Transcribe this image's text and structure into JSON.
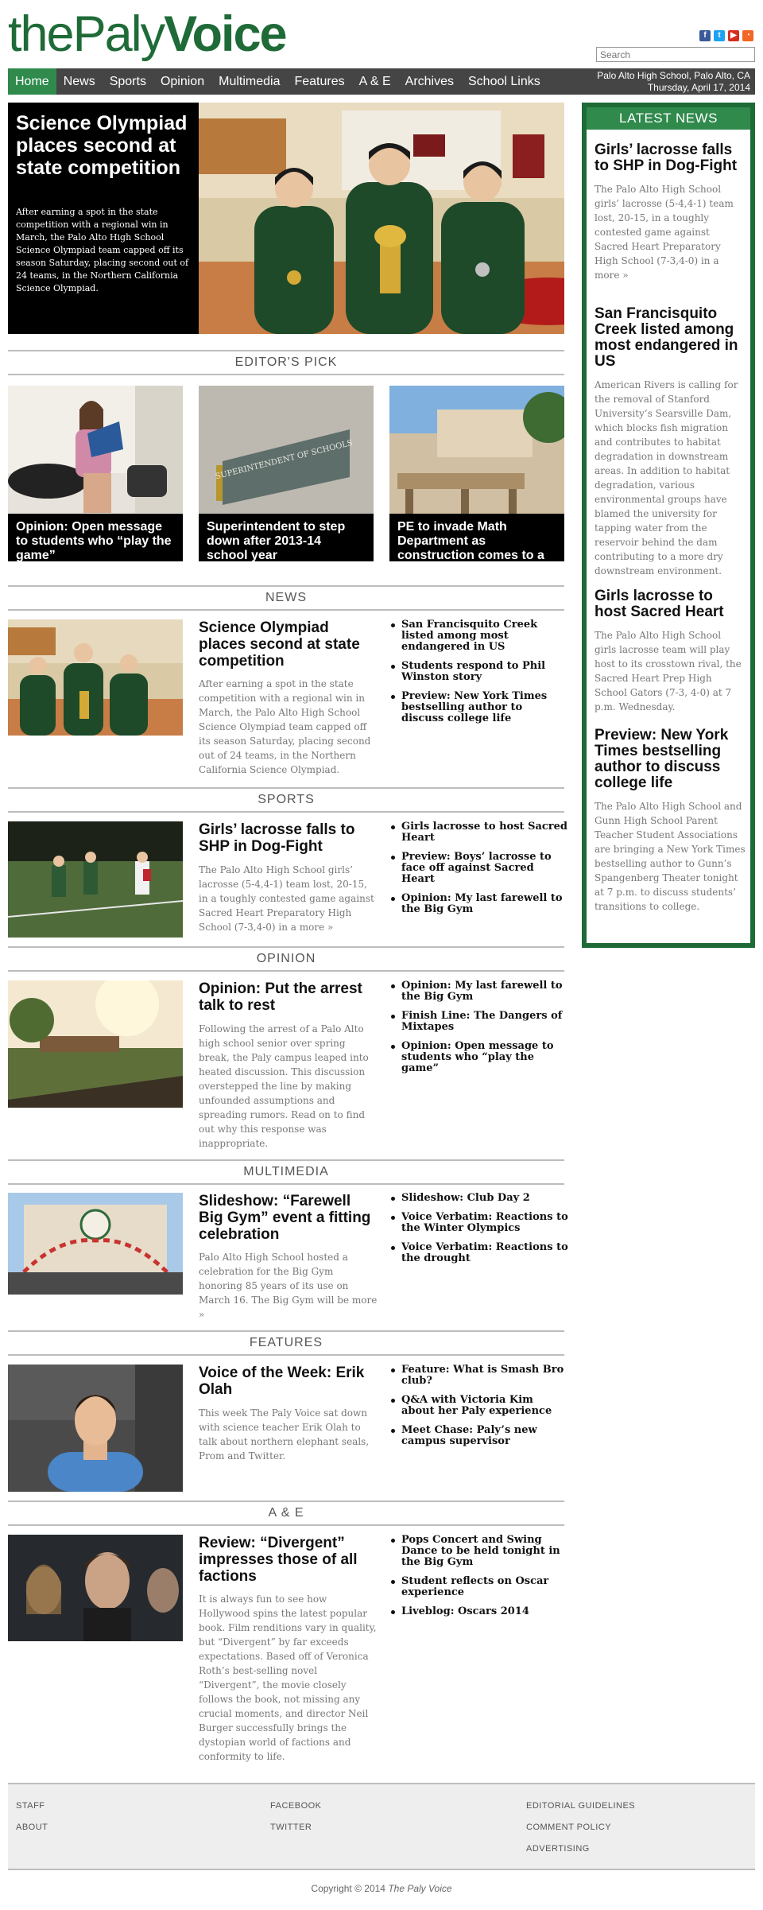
{
  "logo": {
    "part1": "thePaly",
    "part2": "Voice"
  },
  "social": [
    "facebook-icon",
    "twitter-icon",
    "youtube-icon",
    "rss-icon"
  ],
  "search": {
    "placeholder": "Search"
  },
  "nav": {
    "items": [
      "Home",
      "News",
      "Sports",
      "Opinion",
      "Multimedia",
      "Features",
      "A & E",
      "Archives",
      "School Links"
    ],
    "location": "Palo Alto High School, Palo Alto, CA",
    "date": "Thursday, April 17, 2014"
  },
  "hero": {
    "title": "Science Olympiad places second at state competition",
    "dek": "After earning a spot in the state competition with a regional win in March, the Palo Alto High School Science Olympiad team capped off its season Saturday, placing second out of 24 teams, in the Northern California Science Olympiad."
  },
  "editors_pick": {
    "heading": "EDITOR'S PICK",
    "items": [
      {
        "caption": "Opinion: Open message to students who “play the game”"
      },
      {
        "caption": "Superintendent to step down after 2013-14 school year",
        "sign": "SUPERINTENDENT OF SCHOOLS"
      },
      {
        "caption": "PE to invade Math Department as construction comes to a"
      }
    ]
  },
  "sections": {
    "news": {
      "heading": "NEWS",
      "title": "Science Olympiad places second at state competition",
      "body": "After earning a spot in the state competition with a regional win in March, the Palo Alto High School Science Olympiad team capped off its season Saturday, placing second out of 24 teams, in the Northern California Science Olympiad.",
      "links": [
        "San Francisquito Creek listed among most endangered in US",
        "Students respond to Phil Winston story",
        "Preview: New York Times bestselling author to discuss college life"
      ]
    },
    "sports": {
      "heading": "SPORTS",
      "title": "Girls’ lacrosse falls to SHP in Dog-Fight",
      "body": "The Palo Alto High School girls’ lacrosse (5-4,4-1) team lost, 20-15, in a toughly contested game against Sacred Heart Preparatory High School (7-3,4-0) in a more »",
      "links": [
        "Girls lacrosse to host Sacred Heart",
        "Preview: Boys’ lacrosse to face off against Sacred Heart",
        "Opinion: My last farewell to the Big Gym"
      ]
    },
    "opinion": {
      "heading": "OPINION",
      "title": "Opinion: Put the arrest talk to rest",
      "body": "Following the arrest of a Palo Alto high school senior over spring break, the Paly campus leaped into heated discussion. This discussion overstepped the line by making unfounded assumptions and spreading rumors. Read on to find out why this response was inappropriate.",
      "links": [
        "Opinion: My last farewell to the Big Gym",
        "Finish Line: The Dangers of Mixtapes",
        "Opinion: Open message to students who “play the game”"
      ]
    },
    "multimedia": {
      "heading": "MULTIMEDIA",
      "title": "Slideshow: “Farewell Big Gym” event a fitting celebration",
      "body": "Palo Alto High School hosted a celebration for the Big Gym honoring 85 years of its use on March 16. The Big Gym will be more »",
      "links": [
        "Slideshow: Club Day 2",
        "Voice Verbatim: Reactions to the Winter Olympics",
        "Voice Verbatim: Reactions to the drought"
      ]
    },
    "features": {
      "heading": "FEATURES",
      "title": "Voice of the Week: Erik Olah",
      "body": "This week The Paly Voice sat down with science teacher Erik Olah to talk about northern elephant seals, Prom and Twitter.",
      "links": [
        "Feature: What is Smash Bro club?",
        "Q&A with Victoria Kim about her Paly experience",
        "Meet Chase: Paly’s new campus supervisor"
      ]
    },
    "ae": {
      "heading": "A & E",
      "title": "Review: “Divergent” impresses those of all factions",
      "body": "It is always fun to see how Hollywood spins the latest popular book. Film renditions vary in quality, but “Divergent” by far exceeds expectations. Based off of Veronica Roth’s best-selling novel “Divergent”, the movie closely follows the book, not missing any crucial moments, and director Neil Burger successfully brings the dystopian world of factions and conformity to life.",
      "links": [
        "Pops Concert and Swing Dance to be held tonight in the Big Gym",
        "Student reflects on Oscar experience",
        "Liveblog: Oscars 2014"
      ]
    }
  },
  "latest_news": {
    "heading": "LATEST NEWS",
    "items": [
      {
        "title": "Girls’ lacrosse falls to SHP in Dog-Fight",
        "body": "The Palo Alto High School girls’ lacrosse (5-4,4-1) team lost, 20-15, in a toughly contested game against Sacred Heart Preparatory High School (7-3,4-0) in a more »"
      },
      {
        "title": "San Francisquito Creek listed among most endangered in US",
        "body": "American Rivers is calling for the removal of Stanford University’s Searsville Dam, which blocks fish migration and contributes to habitat degradation in downstream areas. In addition to habitat degradation, various environmental groups have blamed the university for tapping water from the reservoir behind the dam contributing to a more dry downstream environment."
      },
      {
        "title": "Girls lacrosse to host Sacred Heart",
        "body": "The Palo Alto High School girls lacrosse team will play host to its crosstown rival, the Sacred Heart Prep High School Gators (7-3, 4-0) at 7 p.m. Wednesday."
      },
      {
        "title": "Preview: New York Times bestselling author to discuss college life",
        "body": "The Palo Alto High School and Gunn High School Parent Teacher Student Associations are bringing a New York Times bestselling author to Gunn’s Spangenberg Theater tonight at 7 p.m. to discuss students’ transitions to college."
      }
    ]
  },
  "footer": {
    "col1": [
      "STAFF",
      "ABOUT"
    ],
    "col2": [
      "FACEBOOK",
      "TWITTER"
    ],
    "col3": [
      "EDITORIAL GUIDELINES",
      "COMMENT POLICY",
      "ADVERTISING"
    ],
    "copyright_prefix": "Copyright © 2014",
    "copyright_name": "The Paly Voice"
  },
  "colors": {
    "brand_green": "#1f6b38",
    "nav_bg": "#454545",
    "active_green": "#2f8a4c"
  }
}
